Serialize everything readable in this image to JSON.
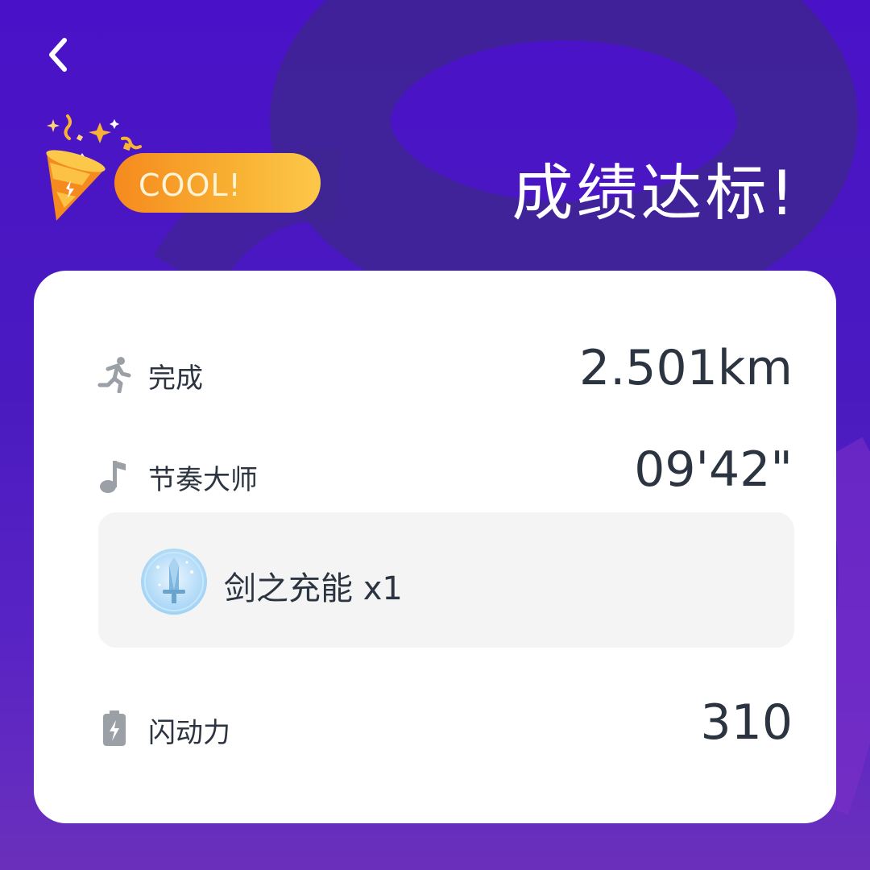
{
  "header": {
    "back_icon": "chevron-left-icon",
    "badge_text": "COOL!",
    "title": "成绩达标!"
  },
  "stats": [
    {
      "icon": "running-person-icon",
      "label": "完成",
      "value": "2.501km"
    },
    {
      "icon": "music-note-icon",
      "label": "节奏大师",
      "value": "09'42\""
    }
  ],
  "reward": {
    "icon": "sword-charge-icon",
    "text": "剑之充能 x1"
  },
  "power": {
    "icon": "battery-icon",
    "label": "闪动力",
    "value": "310"
  },
  "colors": {
    "background": "#4a12c8",
    "card": "#ffffff",
    "text": "#2b3440",
    "badge": "#f9b233",
    "reward_bg": "#f4f4f4"
  }
}
